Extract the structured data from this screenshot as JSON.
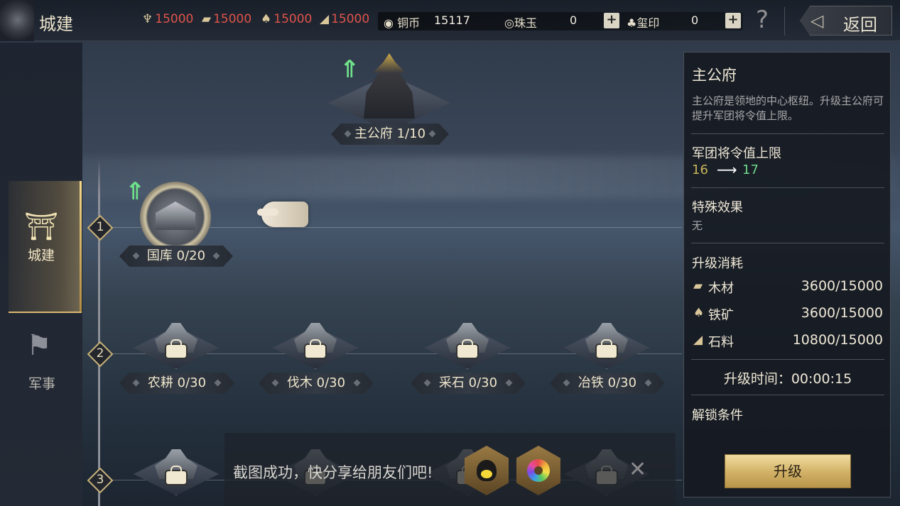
{
  "header": {
    "title": "城建",
    "resources": [
      {
        "icon": "grain-icon",
        "value": "15000"
      },
      {
        "icon": "wood-icon",
        "value": "15000"
      },
      {
        "icon": "iron-icon",
        "value": "15000"
      },
      {
        "icon": "stone-icon",
        "value": "15000"
      }
    ],
    "copper": {
      "icon": "coin-icon",
      "label": "铜币",
      "value": "15117"
    },
    "pearl": {
      "icon": "pearl-icon",
      "label": "珠玉",
      "value": "0"
    },
    "seal": {
      "icon": "seal-icon",
      "label": "玺印",
      "value": "0"
    },
    "plus": "+",
    "help": "?",
    "back": "返回"
  },
  "sidebar": {
    "tabs": [
      {
        "label": "城建",
        "icon": "palace-icon"
      },
      {
        "label": "军事",
        "icon": "flag-icon"
      }
    ]
  },
  "tiers": [
    "1",
    "2",
    "3"
  ],
  "buildings": {
    "main": "主公府 1/10",
    "treasury": "国库 0/20",
    "farm": "农耕 0/30",
    "logging": "伐木 0/30",
    "quarry": "采石 0/30",
    "smelt": "冶铁 0/30"
  },
  "panel": {
    "name": "主公府",
    "desc": "主公府是领地的中心枢纽。升级主公府可提升军团将令值上限。",
    "stat_title": "军团将令值上限",
    "old": "16",
    "new": "17",
    "effect_title": "特殊效果",
    "effect": "无",
    "cost_title": "升级消耗",
    "costs": [
      {
        "icon": "wood-icon",
        "name": "木材",
        "value": "3600/15000"
      },
      {
        "icon": "iron-icon",
        "name": "铁矿",
        "value": "3600/15000"
      },
      {
        "icon": "stone-icon",
        "name": "石料",
        "value": "10800/15000"
      }
    ],
    "time": "升级时间：00:00:15",
    "unlock_title": "解锁条件",
    "upgrade": "升级"
  },
  "toast": {
    "text": "截图成功，快分享给朋友们吧!",
    "close": "✕"
  }
}
